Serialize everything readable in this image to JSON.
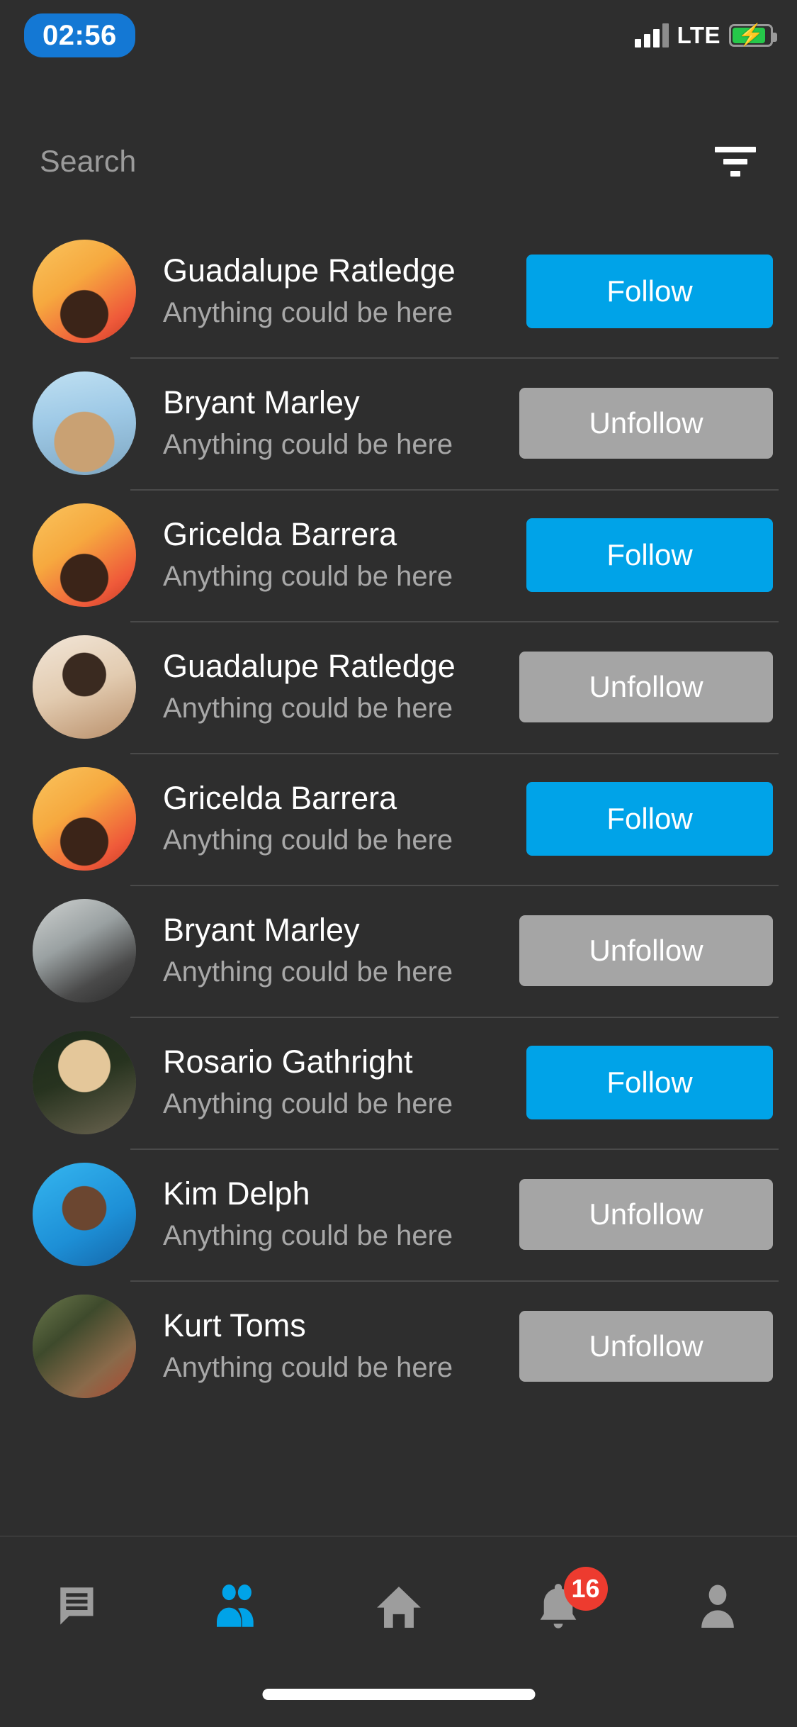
{
  "statusbar": {
    "time": "02:56",
    "network": "LTE",
    "signal_icon": "cellular-signal-icon",
    "battery_icon": "battery-charging-icon",
    "battery_color": "#26C84A",
    "time_pill_color": "#1478D4"
  },
  "header": {
    "search_placeholder": "Search",
    "search_value": "",
    "filter_icon": "filter-icon"
  },
  "theme": {
    "background": "#2e2e2e",
    "follow_color": "#00A3E8",
    "unfollow_color": "#A5A5A5",
    "badge_color": "#ED3B2F",
    "active_tab_color": "#00A3E8",
    "inactive_tab_color": "#9d9d9d"
  },
  "list": {
    "subtitle_text": "Anything could be here",
    "items": [
      {
        "name": "Guadalupe Ratledge",
        "subtitle": "Anything could be here",
        "action": "Follow",
        "state": "follow",
        "avatar": "avatar-orange-portrait"
      },
      {
        "name": "Bryant Marley",
        "subtitle": "Anything could be here",
        "action": "Unfollow",
        "state": "unfollow",
        "avatar": "avatar-blonde-sky"
      },
      {
        "name": "Gricelda Barrera",
        "subtitle": "Anything could be here",
        "action": "Follow",
        "state": "follow",
        "avatar": "avatar-orange-portrait"
      },
      {
        "name": "Guadalupe Ratledge",
        "subtitle": "Anything could be here",
        "action": "Unfollow",
        "state": "unfollow",
        "avatar": "avatar-cream-smile"
      },
      {
        "name": "Gricelda Barrera",
        "subtitle": "Anything could be here",
        "action": "Follow",
        "state": "follow",
        "avatar": "avatar-orange-portrait"
      },
      {
        "name": "Bryant Marley",
        "subtitle": "Anything could be here",
        "action": "Unfollow",
        "state": "unfollow",
        "avatar": "avatar-plane-gray"
      },
      {
        "name": "Rosario Gathright",
        "subtitle": "Anything could be here",
        "action": "Follow",
        "state": "follow",
        "avatar": "avatar-glasses-dark"
      },
      {
        "name": "Kim Delph",
        "subtitle": "Anything could be here",
        "action": "Unfollow",
        "state": "unfollow",
        "avatar": "avatar-blue-bg"
      },
      {
        "name": "Kurt Toms",
        "subtitle": "Anything could be here",
        "action": "Unfollow",
        "state": "unfollow",
        "avatar": "avatar-forest"
      }
    ]
  },
  "tabbar": {
    "tabs": [
      {
        "icon": "chat-icon",
        "active": false
      },
      {
        "icon": "people-icon",
        "active": true
      },
      {
        "icon": "home-icon",
        "active": false
      },
      {
        "icon": "bell-icon",
        "active": false,
        "badge": "16"
      },
      {
        "icon": "person-icon",
        "active": false
      }
    ]
  }
}
